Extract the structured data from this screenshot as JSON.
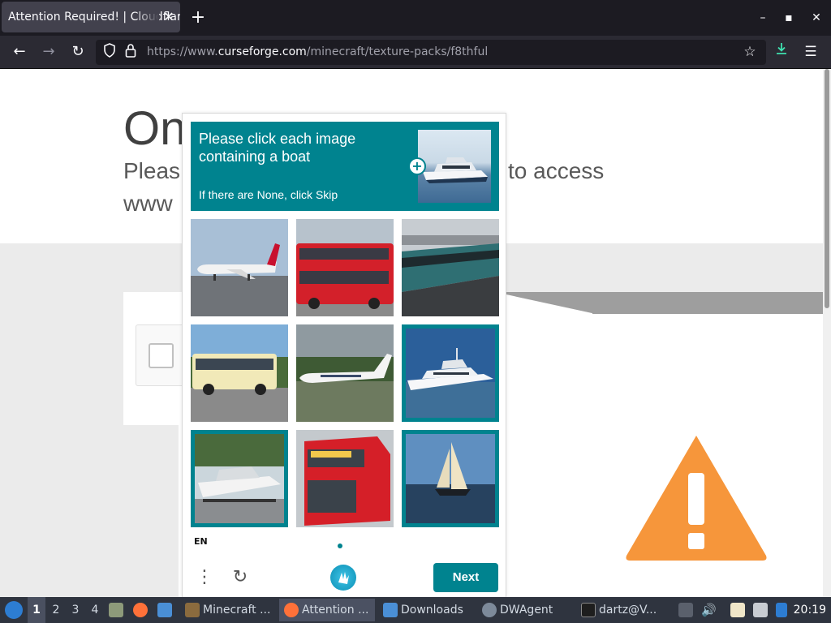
{
  "browser": {
    "tab_title": "Attention Required! | Cloudflare",
    "tab_close": "✕",
    "new_tab": "+",
    "window_buttons": [
      "–",
      "▪",
      "✕"
    ],
    "url_prefix": "https://www.",
    "url_host": "curseforge.com",
    "url_path": "/minecraft/texture-packs/f8thful"
  },
  "page": {
    "title": "One more step",
    "subtitle_start": "Pleas",
    "subtitle_end": "to access",
    "subtitle_line2": "www"
  },
  "captcha": {
    "prompt": "Please click each image containing a boat",
    "prompt_sub": "If there are None, click Skip",
    "language": "EN",
    "next_label": "Next",
    "tiles": [
      {
        "name": "airplane",
        "selected": false
      },
      {
        "name": "double-decker-bus",
        "selected": false
      },
      {
        "name": "train",
        "selected": false
      },
      {
        "name": "coach-bus",
        "selected": false
      },
      {
        "name": "private-jet",
        "selected": false
      },
      {
        "name": "yacht",
        "selected": true
      },
      {
        "name": "motorboat-on-trailer",
        "selected": true
      },
      {
        "name": "red-bus",
        "selected": false
      },
      {
        "name": "sailboat",
        "selected": true
      }
    ]
  },
  "taskbar": {
    "workspaces": [
      "1",
      "2",
      "3",
      "4"
    ],
    "apps": [
      {
        "label": "Minecraft ...",
        "icon": "minecraft-icon"
      },
      {
        "label": "Attention ...",
        "icon": "firefox-icon"
      },
      {
        "label": "Downloads",
        "icon": "folder-icon"
      },
      {
        "label": "DWAgent",
        "icon": "gear-icon"
      },
      {
        "label": "dartz@V...",
        "icon": "terminal-icon"
      }
    ],
    "clock": "20:19"
  },
  "colors": {
    "captcha_accent": "#00838f",
    "warning": "#f6963b"
  }
}
